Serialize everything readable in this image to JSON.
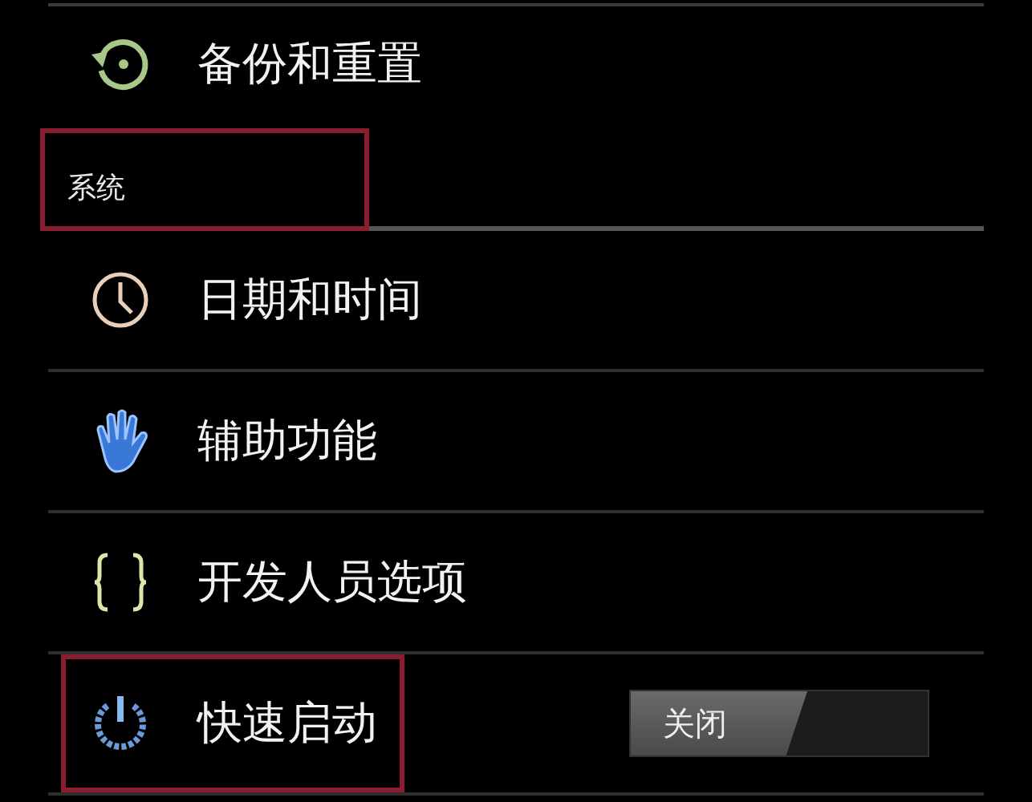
{
  "items": [
    {
      "kind": "item",
      "label": "备份和重置",
      "highlighted": false
    },
    {
      "kind": "header",
      "label": "系统",
      "highlighted": true
    },
    {
      "kind": "item",
      "label": "日期和时间",
      "highlighted": false
    },
    {
      "kind": "item",
      "label": "辅助功能",
      "highlighted": false
    },
    {
      "kind": "item",
      "label": "开发人员选项",
      "highlighted": false
    },
    {
      "kind": "item",
      "label": "快速启动",
      "highlighted": true,
      "toggle": {
        "label": "关闭",
        "on": false
      }
    }
  ]
}
